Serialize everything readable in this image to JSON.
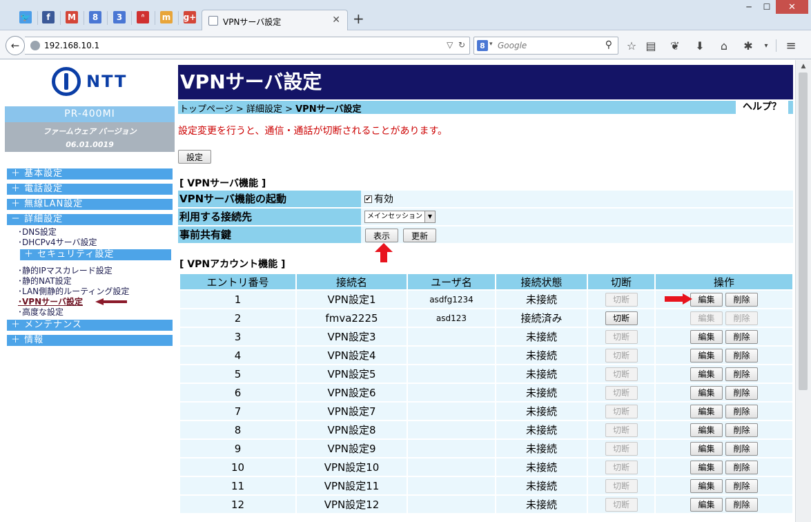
{
  "browser": {
    "pinned_tabs": [
      {
        "icon": "twitter-icon",
        "glyph": "🐦",
        "color": "#4a9de8"
      },
      {
        "icon": "facebook-icon",
        "glyph": "f",
        "color": "#3b5998"
      },
      {
        "icon": "gmail-icon",
        "glyph": "M",
        "color": "#d44638"
      },
      {
        "icon": "google-icon",
        "glyph": "8",
        "color": "#4a77d4"
      },
      {
        "icon": "calendar-icon",
        "glyph": "3",
        "color": "#4a77d4"
      },
      {
        "icon": "nifty-icon",
        "glyph": "ᐢ",
        "color": "#d03030"
      },
      {
        "icon": "smile-icon",
        "glyph": "m",
        "color": "#e8a53a"
      },
      {
        "icon": "google-plus-icon",
        "glyph": "g+",
        "color": "#d44638"
      }
    ],
    "tab_title": "VPNサーバ設定",
    "url": "192.168.10.1",
    "search_engine": "8",
    "search_placeholder": "Google",
    "window": {
      "minimize": "─",
      "maximize": "☐",
      "close": "✕"
    }
  },
  "sidebar": {
    "logo_text": "NTT",
    "model": "PR-400MI",
    "firmware_label": "ファームウェア バージョン",
    "firmware_version": "06.01.0019",
    "categories": {
      "basic": "＋ 基本設定",
      "phone": "＋ 電話設定",
      "wireless": "＋ 無線LAN設定",
      "detail": "－ 詳細設定",
      "security": "＋ セキュリティ設定",
      "maintenance": "＋ メンテナンス",
      "info": "＋ 情報"
    },
    "links": {
      "dns": "･DNS設定",
      "dhcp": "･DHCPv4サーバ設定",
      "ipmasq": "･静的IPマスカレード設定",
      "nat": "･静的NAT設定",
      "lan_routing": "･LAN側静的ルーティング設定",
      "vpn": "･VPNサーバ設定",
      "advanced": "･高度な設定"
    }
  },
  "main": {
    "title": "VPNサーバ設定",
    "breadcrumb": {
      "home": "トップページ",
      "sep": " > ",
      "detail": "詳細設定",
      "current": "VPNサーバ設定"
    },
    "help": "ヘルプ？",
    "warning": "設定変更を行うと、通信・通話が切断されることがあります。",
    "set_button": "設定",
    "vpn_server": {
      "title": "[ VPNサーバ機能 ]",
      "enable_label": "VPNサーバ機能の起動",
      "enable_value": "有効",
      "enable_checked": "✔",
      "connection_label": "利用する接続先",
      "connection_value": "メインセッション",
      "psk_label": "事前共有鍵",
      "show_button": "表示",
      "update_button": "更新"
    },
    "vpn_accounts": {
      "title": "[ VPNアカウント機能 ]",
      "headers": [
        "エントリ番号",
        "接続名",
        "ユーザ名",
        "接続状態",
        "切断",
        "操作"
      ],
      "cut_label": "切断",
      "edit_label": "編集",
      "delete_label": "削除",
      "rows": [
        {
          "entry": "1",
          "name": "VPN設定1",
          "user": "asdfg1234",
          "status": "未接続",
          "cut_enabled": false,
          "ops_enabled": true
        },
        {
          "entry": "2",
          "name": "fmva2225",
          "user": "asd123",
          "status": "接続済み",
          "cut_enabled": true,
          "ops_enabled": false
        },
        {
          "entry": "3",
          "name": "VPN設定3",
          "user": "",
          "status": "未接続",
          "cut_enabled": false,
          "ops_enabled": true
        },
        {
          "entry": "4",
          "name": "VPN設定4",
          "user": "",
          "status": "未接続",
          "cut_enabled": false,
          "ops_enabled": true
        },
        {
          "entry": "5",
          "name": "VPN設定5",
          "user": "",
          "status": "未接続",
          "cut_enabled": false,
          "ops_enabled": true
        },
        {
          "entry": "6",
          "name": "VPN設定6",
          "user": "",
          "status": "未接続",
          "cut_enabled": false,
          "ops_enabled": true
        },
        {
          "entry": "7",
          "name": "VPN設定7",
          "user": "",
          "status": "未接続",
          "cut_enabled": false,
          "ops_enabled": true
        },
        {
          "entry": "8",
          "name": "VPN設定8",
          "user": "",
          "status": "未接続",
          "cut_enabled": false,
          "ops_enabled": true
        },
        {
          "entry": "9",
          "name": "VPN設定9",
          "user": "",
          "status": "未接続",
          "cut_enabled": false,
          "ops_enabled": true
        },
        {
          "entry": "10",
          "name": "VPN設定10",
          "user": "",
          "status": "未接続",
          "cut_enabled": false,
          "ops_enabled": true
        },
        {
          "entry": "11",
          "name": "VPN設定11",
          "user": "",
          "status": "未接続",
          "cut_enabled": false,
          "ops_enabled": true
        },
        {
          "entry": "12",
          "name": "VPN設定12",
          "user": "",
          "status": "未接続",
          "cut_enabled": false,
          "ops_enabled": true
        }
      ]
    }
  },
  "colors": {
    "banner": "#141466",
    "menu": "#4da4e8",
    "table_header": "#8ad0ec",
    "warning": "#cc0000",
    "annotation_arrow": "#e8141e",
    "sidebar_arrow": "#8b1a2a"
  }
}
